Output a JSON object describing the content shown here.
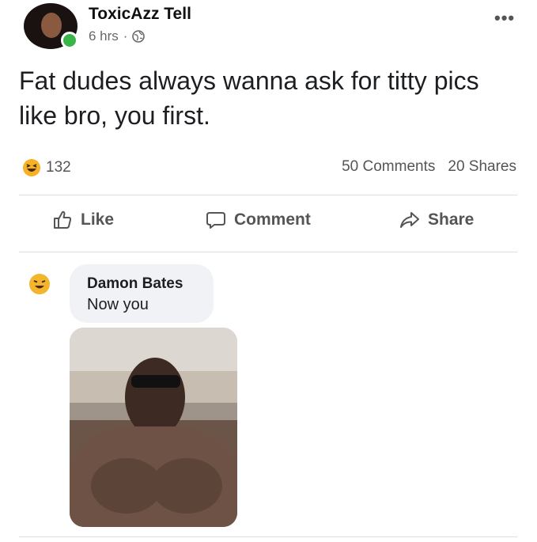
{
  "post": {
    "author": "ToxicAzz Tell",
    "time": "6 hrs",
    "separator": "·",
    "text": "Fat dudes always wanna ask for titty pics like bro, you first.",
    "more_label": "•••"
  },
  "stats": {
    "reaction_count": "132",
    "comments": "50 Comments",
    "shares": "20 Shares"
  },
  "actions": {
    "like": "Like",
    "comment": "Comment",
    "share": "Share"
  },
  "comment": {
    "author": "Damon Bates",
    "text": "Now you"
  },
  "icons": {
    "avatar": "profile-photo",
    "globe": "globe-icon",
    "reaction": "haha-reaction-icon",
    "like": "thumbs-up-icon",
    "comment": "speech-bubble-icon",
    "share": "share-arrow-icon"
  },
  "colors": {
    "online": "#3bb54a",
    "bubble": "#f0f2f5",
    "muted": "#65676b"
  }
}
